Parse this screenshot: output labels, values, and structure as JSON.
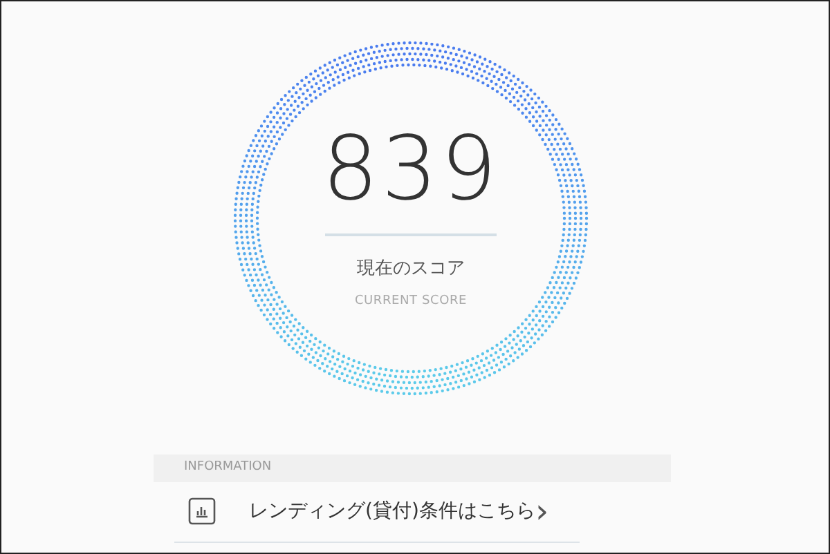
{
  "score": {
    "value": "839",
    "label": "現在のスコア",
    "sublabel": "CURRENT SCORE"
  },
  "information": {
    "heading": "INFORMATION",
    "items": [
      {
        "label": "レンディング(貸付)条件はこちら",
        "chevron": "›"
      }
    ]
  }
}
